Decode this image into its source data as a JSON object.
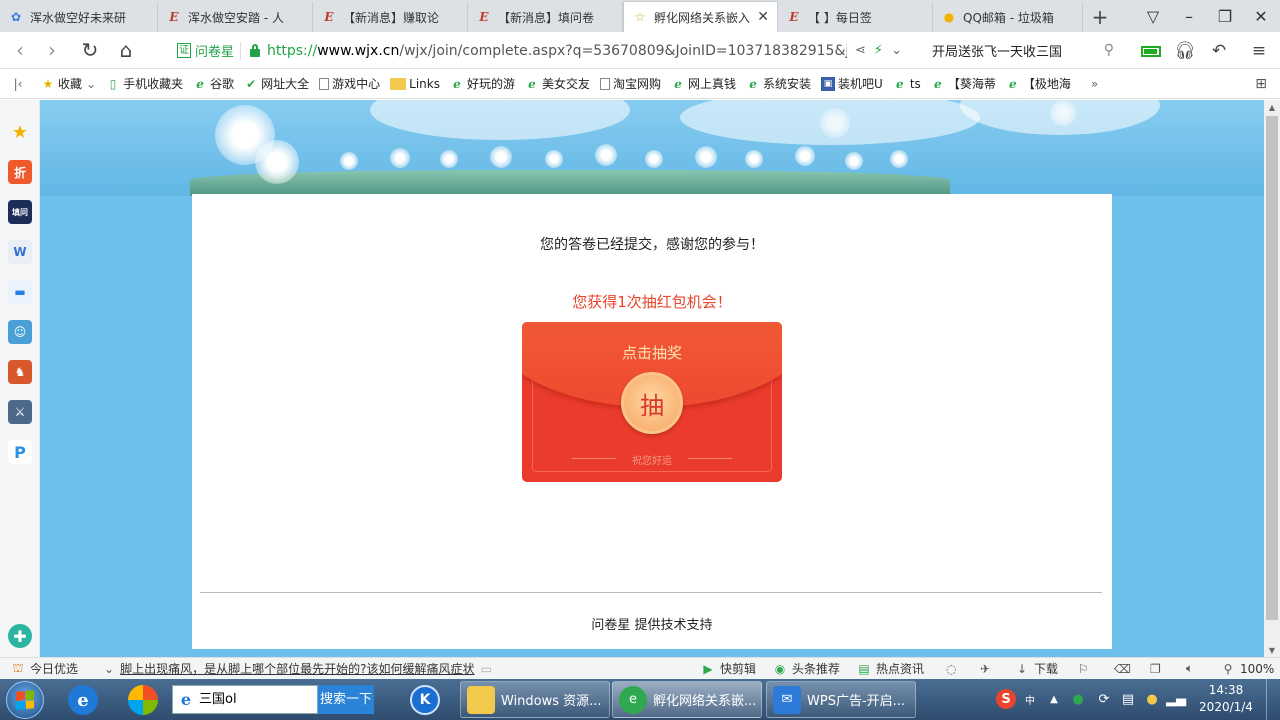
{
  "browser": {
    "tabs": [
      {
        "title": "浑水做空好未来研",
        "icon": "gear-icon"
      },
      {
        "title": "浑水做空安踏 - 人",
        "icon": "ie-icon"
      },
      {
        "title": "【新消息】赚取论",
        "icon": "ie-icon"
      },
      {
        "title": "【新消息】填问卷",
        "icon": "ie-icon"
      },
      {
        "title": "孵化网络关系嵌入",
        "icon": "star-icon",
        "active": true
      },
      {
        "title": "【        】每日签",
        "icon": "ie-icon"
      },
      {
        "title": "QQ邮箱 - 垃圾箱",
        "icon": "qq-icon"
      }
    ],
    "cert_label": "问卷星",
    "cert_badge": "证",
    "url": {
      "scheme": "https://",
      "host": "www.wjx.cn",
      "rest": "/wjx/join/complete.aspx?q=53670809&JoinID=103718382915&jidx"
    },
    "search_text": "开局送张飞一天收三国",
    "bookmarks": [
      {
        "label": "收藏",
        "icon": "star-icon",
        "dropdown": true
      },
      {
        "label": "手机收藏夹",
        "icon": "phone-icon"
      },
      {
        "label": "谷歌",
        "icon": "e-icon"
      },
      {
        "label": "网址大全",
        "icon": "hao-icon"
      },
      {
        "label": "游戏中心",
        "icon": "page-icon"
      },
      {
        "label": "Links",
        "icon": "folder-icon"
      },
      {
        "label": "好玩的游",
        "icon": "e-icon"
      },
      {
        "label": "美女交友",
        "icon": "e-icon"
      },
      {
        "label": "淘宝网购",
        "icon": "page-icon"
      },
      {
        "label": "网上真钱",
        "icon": "e-icon"
      },
      {
        "label": "系统安装",
        "icon": "e-icon"
      },
      {
        "label": "装机吧U",
        "icon": "pc-icon"
      },
      {
        "label": "ts",
        "icon": "e-icon"
      },
      {
        "label": "【葵海蒂",
        "icon": "e-icon"
      },
      {
        "label": "【极地海",
        "icon": "e-icon"
      }
    ],
    "more_bookmarks": "»"
  },
  "page": {
    "thanks": "您的答卷已经提交，感谢您的参与！",
    "chance": "您获得1次抽红包机会！",
    "redpacket": {
      "title": "点击抽奖",
      "button": "抽",
      "wish": "祝您好运"
    },
    "support": "问卷星 提供技术支持"
  },
  "statusbar": {
    "today_pick": "今日优选",
    "news_link": "脚上出现痛风，是从脚上哪个部位最先开始的?该如何缓解痛风症状",
    "quick_cut": "快剪辑",
    "headlines": "头条推荐",
    "hot_news": "热点资讯",
    "download": "下载",
    "zoom": "100%"
  },
  "taskbar": {
    "search_value": "三国ol",
    "search_button": "搜索一下",
    "tasks": [
      {
        "label": "Windows 资源...",
        "icon": "folder-icon"
      },
      {
        "label": "孵化网络关系嵌...",
        "icon": "browser-icon",
        "active": true
      },
      {
        "label": "WPS广告-开启...",
        "icon": "wps-icon"
      }
    ],
    "time": "14:38",
    "date": "2020/1/4"
  },
  "colors": {
    "page_bg": "#6ec0ec",
    "accent_red": "#e8452c",
    "packet_red": "#ea3b2c",
    "cert_green": "#22a34a"
  }
}
